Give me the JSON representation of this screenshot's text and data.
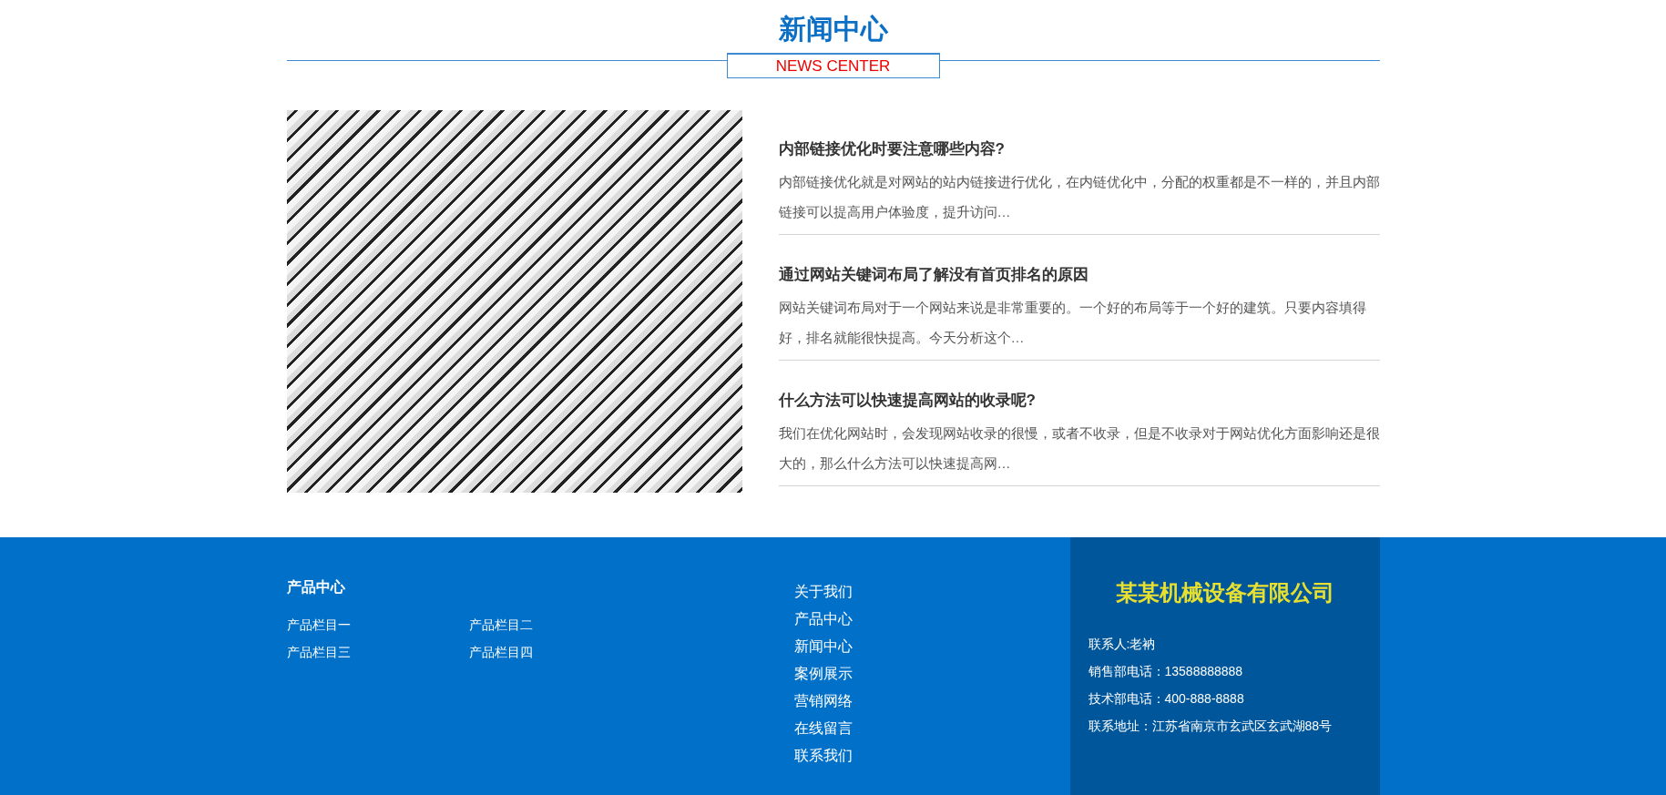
{
  "section": {
    "title": "新闻中心",
    "subtitle": "NEWS CENTER"
  },
  "news": [
    {
      "title": "内部链接优化时要注意哪些内容?",
      "summary": "内部链接优化就是对网站的站内链接进行优化，在内链优化中，分配的权重都是不一样的，并且内部链接可以提高用户体验度，提升访问…"
    },
    {
      "title": "通过网站关键词布局了解没有首页排名的原因",
      "summary": "网站关键词布局对于一个网站来说是非常重要的。一个好的布局等于一个好的建筑。只要内容填得好，排名就能很快提高。今天分析这个…"
    },
    {
      "title": "什么方法可以快速提高网站的收录呢?",
      "summary": "我们在优化网站时，会发现网站收录的很慢，或者不收录，但是不收录对于网站优化方面影响还是很大的，那么什么方法可以快速提高网…"
    }
  ],
  "footer": {
    "products": {
      "heading": "产品中心",
      "items": [
        "产品栏目一",
        "产品栏目二",
        "产品栏目三",
        "产品栏目四"
      ]
    },
    "nav": [
      "关于我们",
      "产品中心",
      "新闻中心",
      "案例展示",
      "营销网络",
      "在线留言",
      "联系我们"
    ],
    "company": {
      "name": "某某机械设备有限公司",
      "contacts": [
        "联系人:老衲",
        "销售部电话：13588888888",
        "技术部电话：400-888-8888",
        "联系地址：江苏省南京市玄武区玄武湖88号"
      ]
    }
  }
}
